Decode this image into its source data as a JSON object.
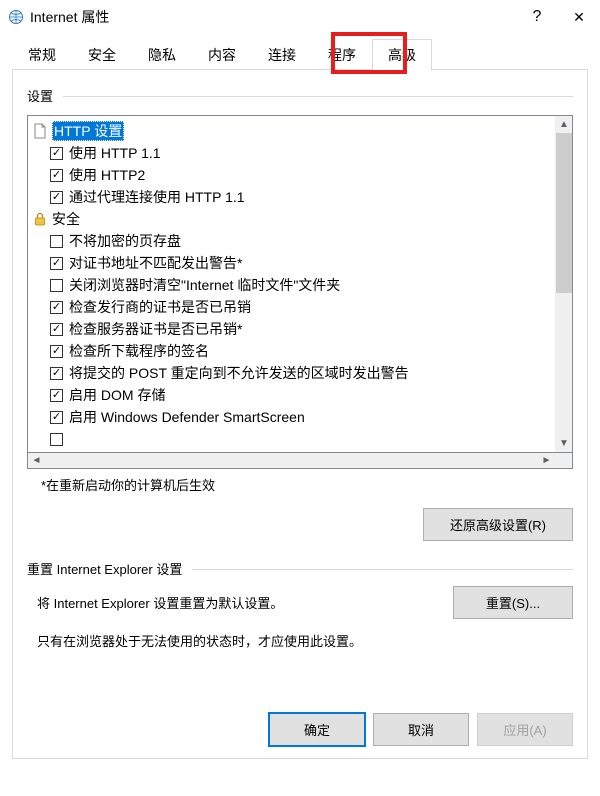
{
  "titlebar": {
    "title": "Internet 属性",
    "help": "?",
    "close": "✕"
  },
  "tabs": {
    "items": [
      {
        "label": "常规"
      },
      {
        "label": "安全"
      },
      {
        "label": "隐私"
      },
      {
        "label": "内容"
      },
      {
        "label": "连接"
      },
      {
        "label": "程序"
      },
      {
        "label": "高级"
      }
    ],
    "active_index": 6
  },
  "settings_group": {
    "label": "设置"
  },
  "tree": {
    "http_section": {
      "label": "HTTP 设置"
    },
    "http_items": [
      {
        "checked": true,
        "label": "使用 HTTP 1.1"
      },
      {
        "checked": true,
        "label": "使用 HTTP2"
      },
      {
        "checked": true,
        "label": "通过代理连接使用 HTTP 1.1"
      }
    ],
    "security_section": {
      "label": "安全"
    },
    "security_items": [
      {
        "checked": false,
        "label": "不将加密的页存盘"
      },
      {
        "checked": true,
        "label": "对证书地址不匹配发出警告*"
      },
      {
        "checked": false,
        "label": "关闭浏览器时清空\"Internet 临时文件\"文件夹"
      },
      {
        "checked": true,
        "label": "检查发行商的证书是否已吊销"
      },
      {
        "checked": true,
        "label": "检查服务器证书是否已吊销*"
      },
      {
        "checked": true,
        "label": "检查所下载程序的签名"
      },
      {
        "checked": true,
        "label": "将提交的 POST 重定向到不允许发送的区域时发出警告"
      },
      {
        "checked": true,
        "label": "启用 DOM 存储"
      },
      {
        "checked": true,
        "label": "启用 Windows Defender SmartScreen"
      },
      {
        "checked": false,
        "label": ""
      }
    ]
  },
  "note": "*在重新启动你的计算机后生效",
  "restore_button": "还原高级设置(R)",
  "reset_group": {
    "label": "重置 Internet Explorer 设置",
    "text": "将 Internet Explorer 设置重置为默认设置。",
    "button": "重置(S)...",
    "hint": "只有在浏览器处于无法使用的状态时，才应使用此设置。"
  },
  "footer": {
    "ok": "确定",
    "cancel": "取消",
    "apply": "应用(A)"
  }
}
